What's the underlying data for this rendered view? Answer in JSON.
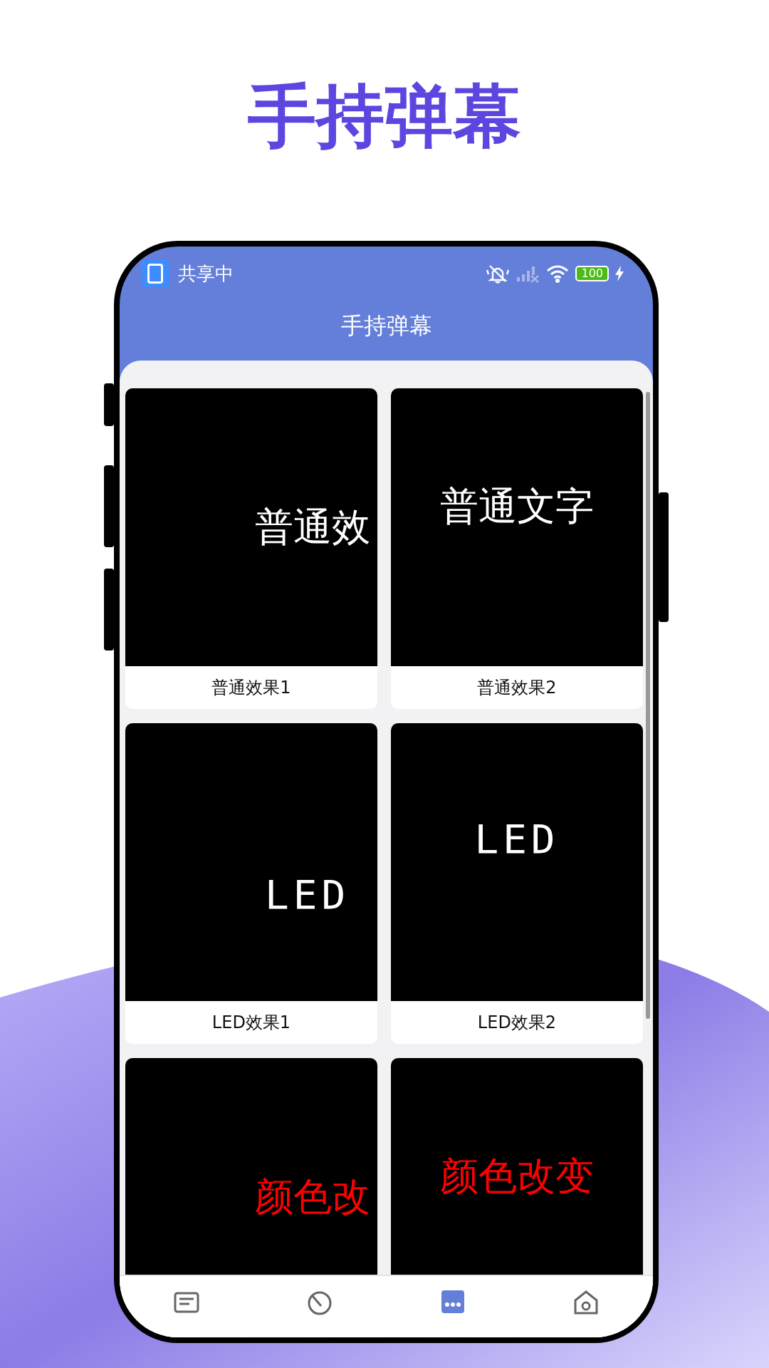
{
  "headline": "手持弹幕",
  "status_bar": {
    "label": "共享中",
    "battery": "100"
  },
  "app_bar": {
    "title": "手持弹幕"
  },
  "cards": [
    {
      "kind": "plain",
      "preview": "普通效",
      "caption": "普通效果1",
      "color": "#ffffff"
    },
    {
      "kind": "plain",
      "preview": "普通文字",
      "caption": "普通效果2",
      "color": "#ffffff"
    },
    {
      "kind": "led",
      "preview": "LED",
      "caption": "LED效果1",
      "color": "#ffffff"
    },
    {
      "kind": "led",
      "preview": "LED",
      "caption": "LED效果2",
      "color": "#ffffff"
    },
    {
      "kind": "plain",
      "preview": "颜色改",
      "color": "#ff0000"
    },
    {
      "kind": "plain",
      "preview": "颜色改变",
      "color": "#ff0000"
    }
  ],
  "nav": [
    {
      "selected": false
    },
    {
      "selected": false
    },
    {
      "selected": true
    },
    {
      "selected": false
    }
  ]
}
